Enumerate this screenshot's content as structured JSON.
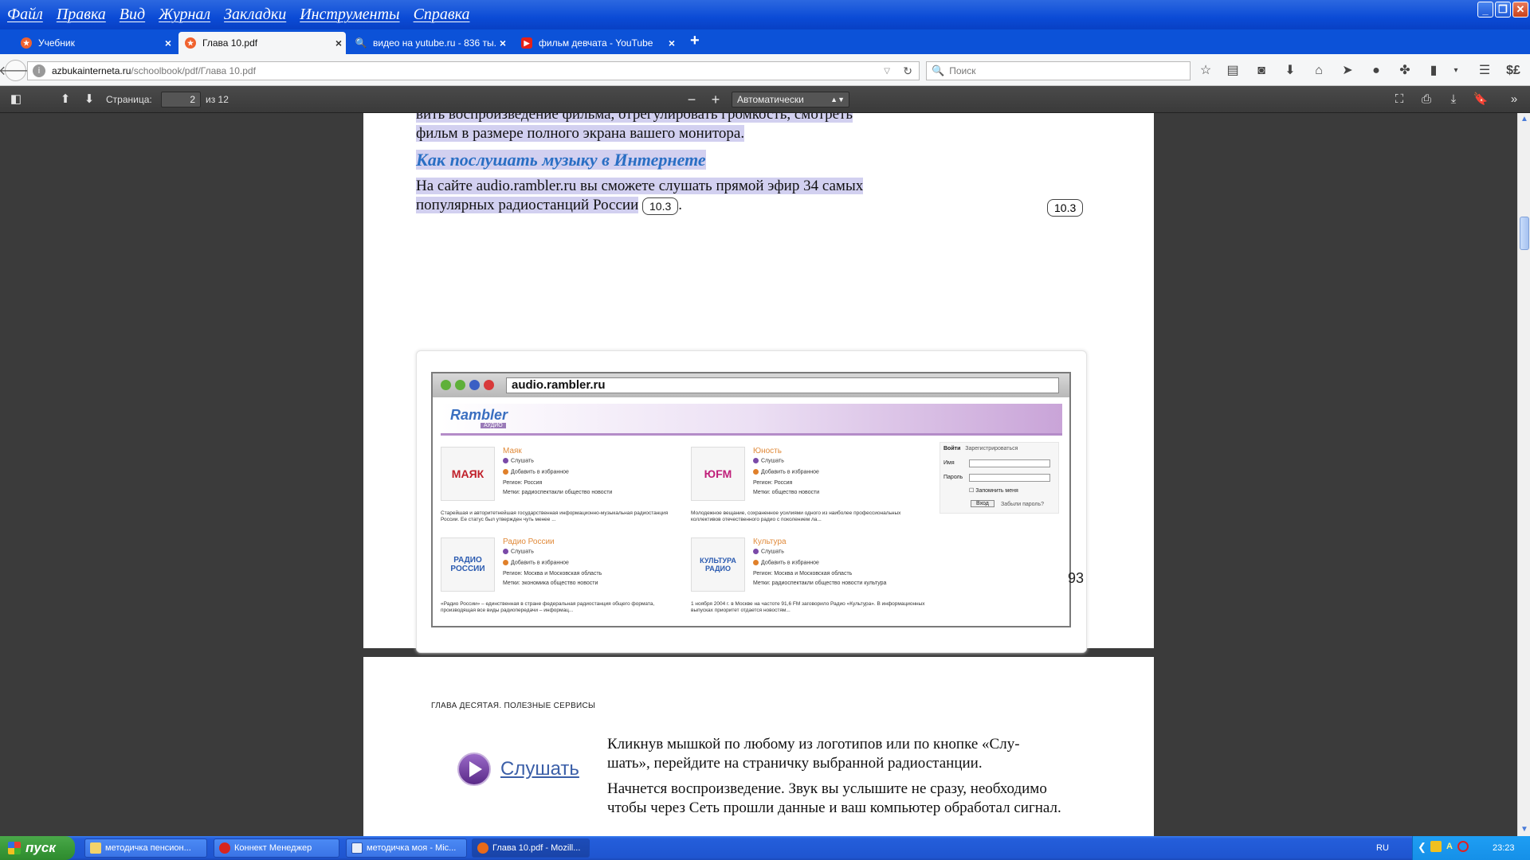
{
  "menu": [
    "Файл",
    "Правка",
    "Вид",
    "Журнал",
    "Закладки",
    "Инструменты",
    "Справка"
  ],
  "tabs": [
    {
      "title": "Учебник"
    },
    {
      "title": "Глава 10.pdf"
    },
    {
      "title": "видео на yutube.ru - 836 ты..."
    },
    {
      "title": "фильм девчата - YouTube"
    }
  ],
  "nav": {
    "url_host": "azbukainterneta.ru",
    "url_path": "/schoolbook/pdf/Глава 10.pdf",
    "search_placeholder": "Поиск"
  },
  "pdf_toolbar": {
    "page_label": "Страница:",
    "page_value": "2",
    "page_count": "из 12",
    "zoom": "Автоматически"
  },
  "page1": {
    "line0": "вить воспроизведение фильма, отрегулировать громкость, смотреть",
    "line1": "фильм в размере полного экрана вашего монитора.",
    "heading": "Как послушать музыку в Интернете",
    "para_a": "На сайте audio.rambler.ru вы сможете слушать прямой эфир 34 самых",
    "para_b": "популярных радиостанций России",
    "badge": "10.3",
    "period": ".",
    "side_badge": "10.3",
    "page_number": "93"
  },
  "figure": {
    "address": "audio.rambler.ru",
    "logo": "Rambler",
    "logo_sub": "АУДИО",
    "stations": [
      {
        "name": "Маяк",
        "logo_text": "МАЯК",
        "listen": "Слушать",
        "fav": "Добавить в избранное",
        "region": "Регион: Россия",
        "tags": "Метки:   радиоспектакли общество новости",
        "desc": "Старейшая и авторитетнейшая государственная информационно-музыкальная радиостанция России. Ее статус был утвержден чуть менее ..."
      },
      {
        "name": "Юность",
        "logo_text": "ЮFM",
        "listen": "Слушать",
        "fav": "Добавить в избранное",
        "region": "Регион: Россия",
        "tags": "Метки:   общество новости",
        "desc": "Молодежное вещание, сохраненное усилиями одного из наиболее профессиональных коллективов отечественного радио с поколением ла..."
      },
      {
        "name": "Радио России",
        "logo_text": "РАДИО РОССИИ",
        "listen": "Слушать",
        "fav": "Добавить в избранное",
        "region": "Регион: Москва и Московская область",
        "tags": "Метки:   экономика общество новости",
        "desc": "«Радио России» – единственная в стране федеральная радиостанция общего формата, производящая все виды радиопередачи – информац..."
      },
      {
        "name": "Культура",
        "logo_text": "КУЛЬТУРА РАДИО",
        "listen": "Слушать",
        "fav": "Добавить в избранное",
        "region": "Регион: Москва и Московская область",
        "tags": "Метки:   радиоспектакли общество новости культура",
        "desc": "1 ноября 2004 г. в Москве на частоте 91,6 FM заговорило Радио «Культура». В информационных выпусках приоритет отдается новостям..."
      }
    ],
    "login": {
      "enter": "Войти",
      "register": "Зарегистрироваться",
      "name": "Имя",
      "password": "Пароль",
      "remember": "Запомнить меня",
      "button": "Вход",
      "forgot": "Забыли пароль?"
    }
  },
  "page2": {
    "chapter": "ГЛАВА ДЕСЯТАЯ. ПОЛЕЗНЫЕ СЕРВИСЫ",
    "listen_text": "Слушать",
    "p1a": "Кликнув мышкой по любому из логотипов или по кнопке «Слу-",
    "p1b": "шать», перейдите на страничку выбранной радиостанции.",
    "p2a": "Начнется воспроизведение. Звук вы услышите не сразу, необходимо",
    "p2b": "чтобы через Сеть прошли данные и ваш компьютер обработал сигнал."
  },
  "taskbar": {
    "start": "пуск",
    "tasks": [
      {
        "title": "методичка пенсион..."
      },
      {
        "title": "Коннект Менеджер"
      },
      {
        "title": "методичка моя - Mic..."
      },
      {
        "title": "Глава 10.pdf - Mozill..."
      }
    ],
    "lang": "RU",
    "clock": "23:23"
  },
  "colors": {
    "xp_blue": "#0b4bd6",
    "highlight": "#d2d0f0",
    "heading": "#2a6fc4",
    "start_green": "#3a9a3a"
  }
}
